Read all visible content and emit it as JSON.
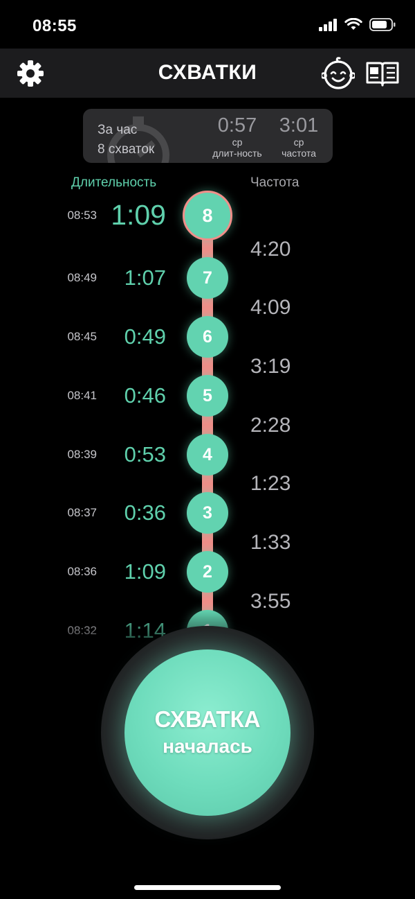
{
  "status_bar": {
    "time": "08:55"
  },
  "nav": {
    "title": "СХВАТКИ",
    "settings_icon": "gear-icon",
    "baby_icon": "baby-face-icon",
    "book_icon": "book-icon"
  },
  "summary": {
    "period": "За час",
    "count": "8 схваток",
    "avg_duration": {
      "value": "0:57",
      "label1": "ср",
      "label2": "длит-ность"
    },
    "avg_frequency": {
      "value": "3:01",
      "label1": "ср",
      "label2": "частота"
    }
  },
  "columns": {
    "duration": "Длительность",
    "frequency": "Частота"
  },
  "contractions": [
    {
      "number": "8",
      "time": "08:53",
      "duration": "1:09"
    },
    {
      "number": "7",
      "time": "08:49",
      "duration": "1:07"
    },
    {
      "number": "6",
      "time": "08:45",
      "duration": "0:49"
    },
    {
      "number": "5",
      "time": "08:41",
      "duration": "0:46"
    },
    {
      "number": "4",
      "time": "08:39",
      "duration": "0:53"
    },
    {
      "number": "3",
      "time": "08:37",
      "duration": "0:36"
    },
    {
      "number": "2",
      "time": "08:36",
      "duration": "1:09"
    },
    {
      "number": "1",
      "time": "08:32",
      "duration": "1:14"
    }
  ],
  "frequencies": [
    "4:20",
    "4:09",
    "3:19",
    "2:28",
    "1:23",
    "1:33",
    "3:55"
  ],
  "start_button": {
    "line1": "СХВАТКА",
    "line2": "началась"
  },
  "colors": {
    "accent": "#62d3b0",
    "connector": "#f08e89",
    "background": "#000000",
    "card": "#2c2c2e"
  }
}
